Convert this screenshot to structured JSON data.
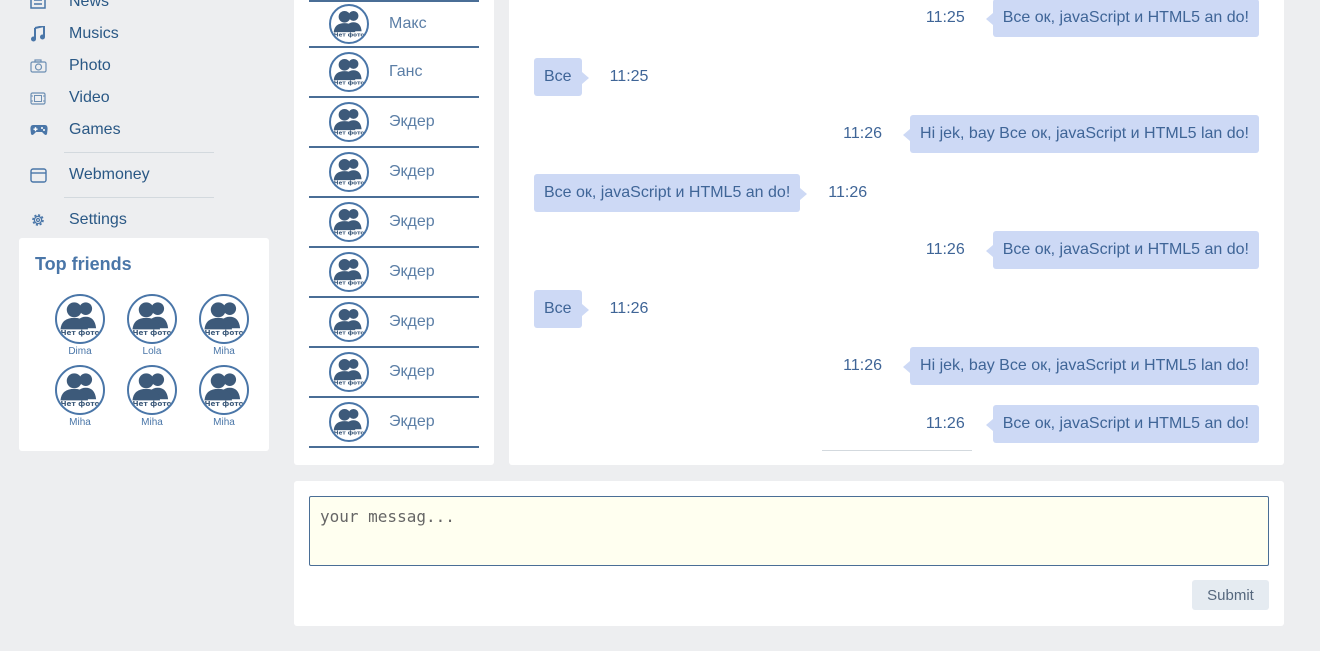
{
  "nav": {
    "items": [
      {
        "label": "News",
        "icon": "news-icon"
      },
      {
        "label": "Musics",
        "icon": "music-icon"
      },
      {
        "label": "Photo",
        "icon": "camera-icon"
      },
      {
        "label": "Video",
        "icon": "video-icon"
      },
      {
        "label": "Games",
        "icon": "gamepad-icon"
      }
    ],
    "webmoney": {
      "label": "Webmoney",
      "icon": "wallet-icon"
    },
    "settings": {
      "label": "Settings",
      "icon": "gear-icon"
    }
  },
  "top_friends": {
    "title": "Top friends",
    "friends": [
      "Dima",
      "Lola",
      "Miha",
      "Miha",
      "Miha",
      "Miha"
    ]
  },
  "avatar_placeholder_text": "Нет фото",
  "contacts": [
    "Макс",
    "Ганс",
    "Экдер",
    "Экдер",
    "Экдер",
    "Экдер",
    "Экдер",
    "Экдер",
    "Экдер"
  ],
  "messages": [
    {
      "dir": "out",
      "text": "Все ок, javaScript и HTML5 an do!",
      "time": "11:25"
    },
    {
      "dir": "in",
      "text": "Все",
      "time": "11:25"
    },
    {
      "dir": "out",
      "text": "Hi jek, bay Все ок, javaScript и HTML5 lan do!",
      "time": "11:26"
    },
    {
      "dir": "in",
      "text": "Все ок, javaScript и HTML5 an do!",
      "time": "11:26"
    },
    {
      "dir": "out",
      "text": "Все ок, javaScript и HTML5 an do!",
      "time": "11:26"
    },
    {
      "dir": "in",
      "text": "Все",
      "time": "11:26"
    },
    {
      "dir": "out",
      "text": "Hi jek, bay Все ок, javaScript и HTML5 lan do!",
      "time": "11:26"
    },
    {
      "dir": "out",
      "text": "Все ок, javaScript и HTML5 an do!",
      "time": "11:26"
    }
  ],
  "compose": {
    "placeholder": "your messag...",
    "submit_label": "Submit"
  },
  "colors": {
    "accent": "#4a76a8",
    "bubble": "#cdd9f5",
    "background": "#edeef0"
  }
}
